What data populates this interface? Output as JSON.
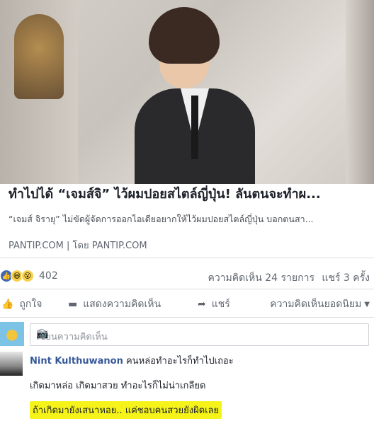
{
  "link_preview": {
    "title": "ทำไปได้ “เจมส์จิ” ไว้ผมปอยสไตล์ญี่ปุ่น! ลันตนจะทำผ...",
    "description": "“เจมส์ จิรายุ” ไม่ขัดผู้จัดการออกไอเดียอยากให้ไว้ผมปอยสไตล์ญี่ปุ่น บอกตนสา...",
    "source": "PANTIP.COM | โดย PANTIP.COM"
  },
  "reactions": {
    "icons": [
      "like-icon",
      "haha-icon",
      "wow-icon"
    ],
    "count": "402",
    "comments_count": "ความคิดเห็น 24 รายการ",
    "shares_count": "แชร์ 3 ครั้ง"
  },
  "actions": {
    "like": "ถูกใจ",
    "comment": "แสดงความคิดเห็น",
    "share": "แชร์",
    "sort": "ความคิดเห็นยอดนิยม"
  },
  "comment_input": {
    "placeholder": "เขียนความคิดเห็น"
  },
  "comment": {
    "author": "Nint Kulthuwanon",
    "text1": "คนหล่อทำอะไรก็ทำไปเถอะ",
    "text2": "เกิดมาหล่อ เกิดมาสวย ทำอะไรก็ไม่น่าเกลียด",
    "text3": "ถ้าเกิดมายังเสนาหอย.. แค่ชอบคนสวยยังผิดเลย",
    "highlight_color": "#f5f31a"
  },
  "colors": {
    "link_blue": "#365899",
    "text_gray": "#606770",
    "like_blue": "#4267b2"
  }
}
